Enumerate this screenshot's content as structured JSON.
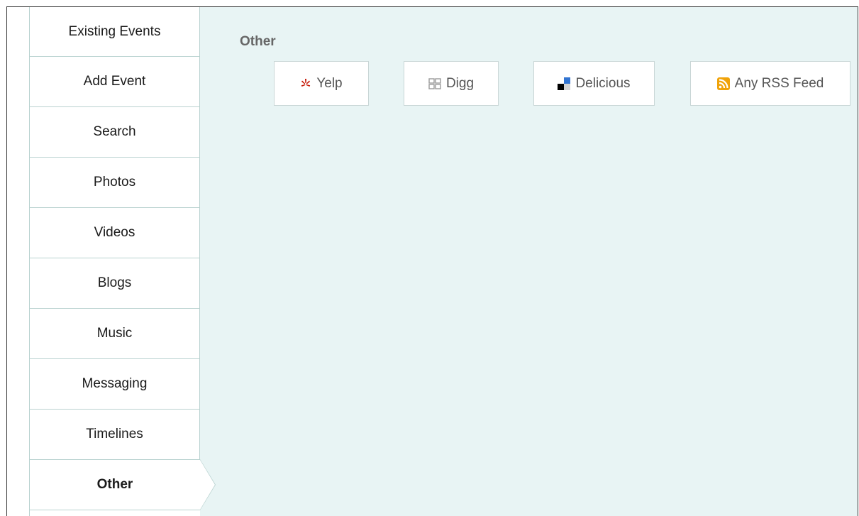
{
  "sidebar": {
    "items": [
      {
        "label": "Existing Events",
        "active": false
      },
      {
        "label": "Add Event",
        "active": false
      },
      {
        "label": "Search",
        "active": false
      },
      {
        "label": "Photos",
        "active": false
      },
      {
        "label": "Videos",
        "active": false
      },
      {
        "label": "Blogs",
        "active": false
      },
      {
        "label": "Music",
        "active": false
      },
      {
        "label": "Messaging",
        "active": false
      },
      {
        "label": "Timelines",
        "active": false
      },
      {
        "label": "Other",
        "active": true
      }
    ]
  },
  "main": {
    "section_title": "Other",
    "sources": [
      {
        "label": "Yelp",
        "icon": "yelp-icon",
        "color": "#c41200"
      },
      {
        "label": "Digg",
        "icon": "digg-icon",
        "color": "#9a9a9a"
      },
      {
        "label": "Delicious",
        "icon": "delicious-icon",
        "color": "#3274d1"
      },
      {
        "label": "Any RSS Feed",
        "icon": "rss-icon",
        "color": "#f0a30a"
      }
    ]
  },
  "colors": {
    "sidebar_border": "#b9d2d0",
    "content_bg": "#e8f4f4",
    "title_text": "#666666"
  }
}
